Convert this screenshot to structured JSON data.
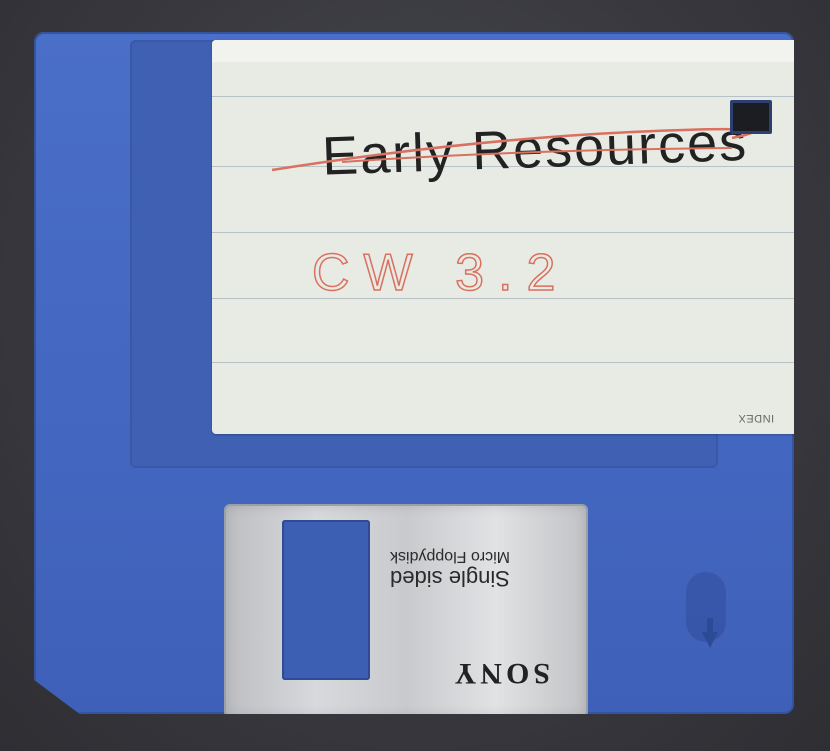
{
  "label": {
    "line1": "Early Resources",
    "line2": "CW 3.2",
    "brand_mark": "INDEX"
  },
  "shutter": {
    "type_line1": "Single sided",
    "type_line2": "Micro Floppydisk",
    "brand": "SONY"
  },
  "colors": {
    "disk_blue": "#4468c2",
    "label_paper": "#e8ebe4",
    "ink_black": "#222222",
    "ink_red": "#d97060"
  },
  "icons": [
    "write-protect-hole",
    "insert-direction-arrow-icon"
  ]
}
